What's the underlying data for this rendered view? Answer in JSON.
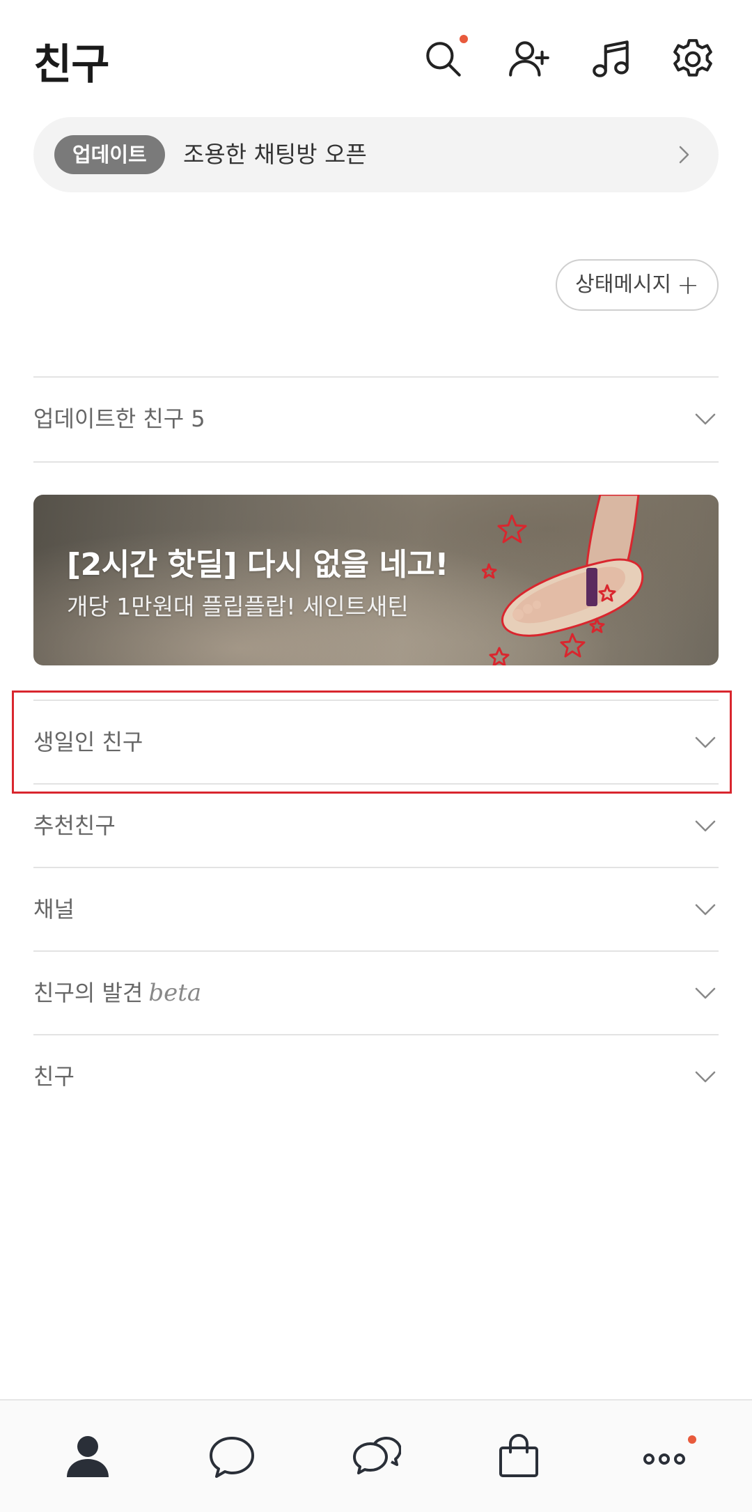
{
  "header": {
    "title": "친구",
    "icons": [
      "search-icon",
      "add-friend-icon",
      "music-icon",
      "settings-icon"
    ],
    "notification_color": "#e85a3c"
  },
  "update_bar": {
    "badge": "업데이트",
    "text": "조용한 채팅방 오픈"
  },
  "status_button": {
    "label": "상태메시지",
    "plus": "+"
  },
  "sections": [
    {
      "label": "업데이트한 친구",
      "count": "5"
    },
    {
      "label": "생일인 친구"
    },
    {
      "label": "추천친구"
    },
    {
      "label": "채널"
    },
    {
      "label": "친구의 발견",
      "suffix": "beta"
    },
    {
      "label": "친구"
    }
  ],
  "ad": {
    "title": "[2시간 핫딜] 다시 없을 네고!",
    "subtitle": "개당 1만원대 플립플랍! 세인트새틴"
  },
  "highlight_color": "#d9262e",
  "bottom_nav": {
    "items": [
      "friends-icon",
      "chat-icon",
      "open-chat-icon",
      "shopping-icon",
      "more-icon"
    ]
  }
}
